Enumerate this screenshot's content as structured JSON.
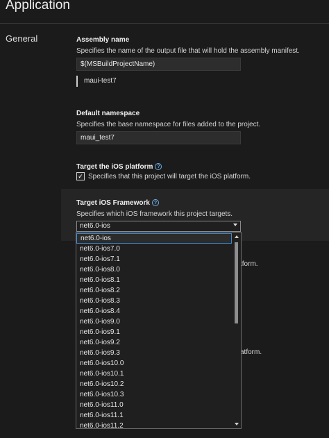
{
  "page": {
    "title": "Application"
  },
  "nav": {
    "section": "General"
  },
  "assembly": {
    "label": "Assembly name",
    "description": "Specifies the name of the output file that will hold the assembly manifest.",
    "value": "$(MSBuildProjectName)",
    "evaluated": "maui-test7"
  },
  "namespace": {
    "label": "Default namespace",
    "description": "Specifies the base namespace for files added to the project.",
    "value": "maui_test7"
  },
  "ios_platform": {
    "label": "Target the iOS platform",
    "checkbox_label": "Specifies that this project will target the iOS platform.",
    "checked": true
  },
  "ios_framework": {
    "label": "Target iOS Framework",
    "description": "Specifies which iOS framework this project targets.",
    "selected": "net6.0-ios",
    "options": [
      "net6.0-ios",
      "net6.0-ios7.0",
      "net6.0-ios7.1",
      "net6.0-ios8.0",
      "net6.0-ios8.1",
      "net6.0-ios8.2",
      "net6.0-ios8.3",
      "net6.0-ios8.4",
      "net6.0-ios9.0",
      "net6.0-ios9.1",
      "net6.0-ios9.2",
      "net6.0-ios9.3",
      "net6.0-ios10.0",
      "net6.0-ios10.1",
      "net6.0-ios10.2",
      "net6.0-ios10.3",
      "net6.0-ios11.0",
      "net6.0-ios11.1",
      "net6.0-ios11.2"
    ]
  },
  "clipped_text": {
    "line1": "tform.",
    "line2": "atform."
  },
  "colors": {
    "background": "#1b1b1b",
    "accent": "#3c86c9"
  }
}
